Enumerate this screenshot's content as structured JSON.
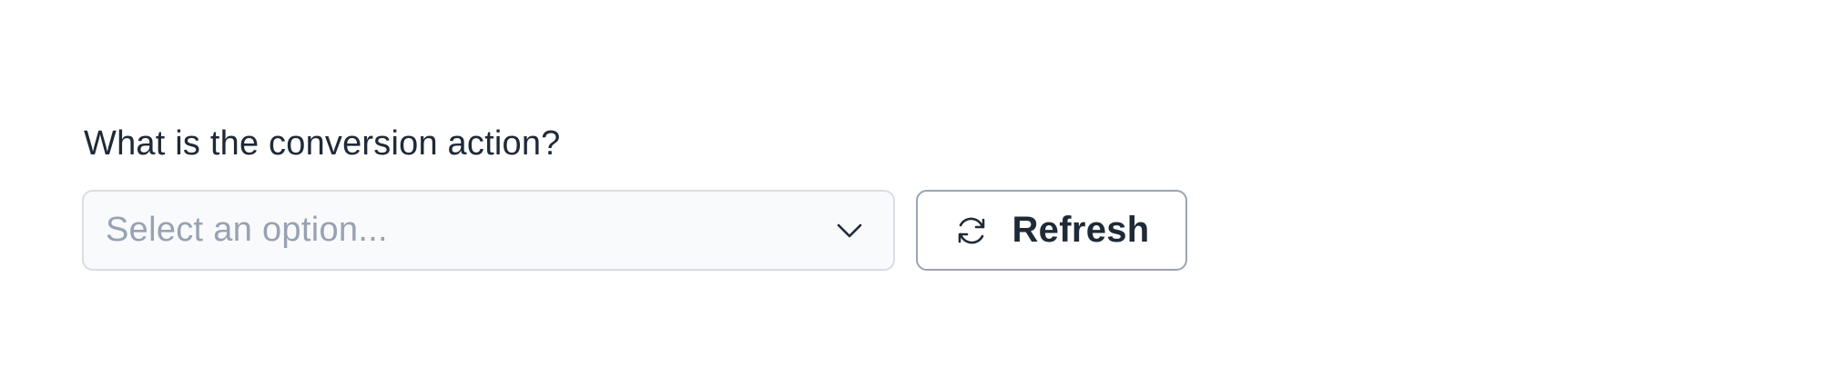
{
  "question": {
    "label": "What is the conversion action?"
  },
  "select": {
    "placeholder": "Select an option...",
    "icon": "chevron-down-icon"
  },
  "refresh_button": {
    "label": "Refresh",
    "icon": "refresh-icon"
  },
  "colors": {
    "text": "#1f2a37",
    "placeholder": "#98a2b3",
    "select_background": "#f8fafc",
    "select_border": "#d8dee6",
    "button_border": "#9aa4b2"
  }
}
